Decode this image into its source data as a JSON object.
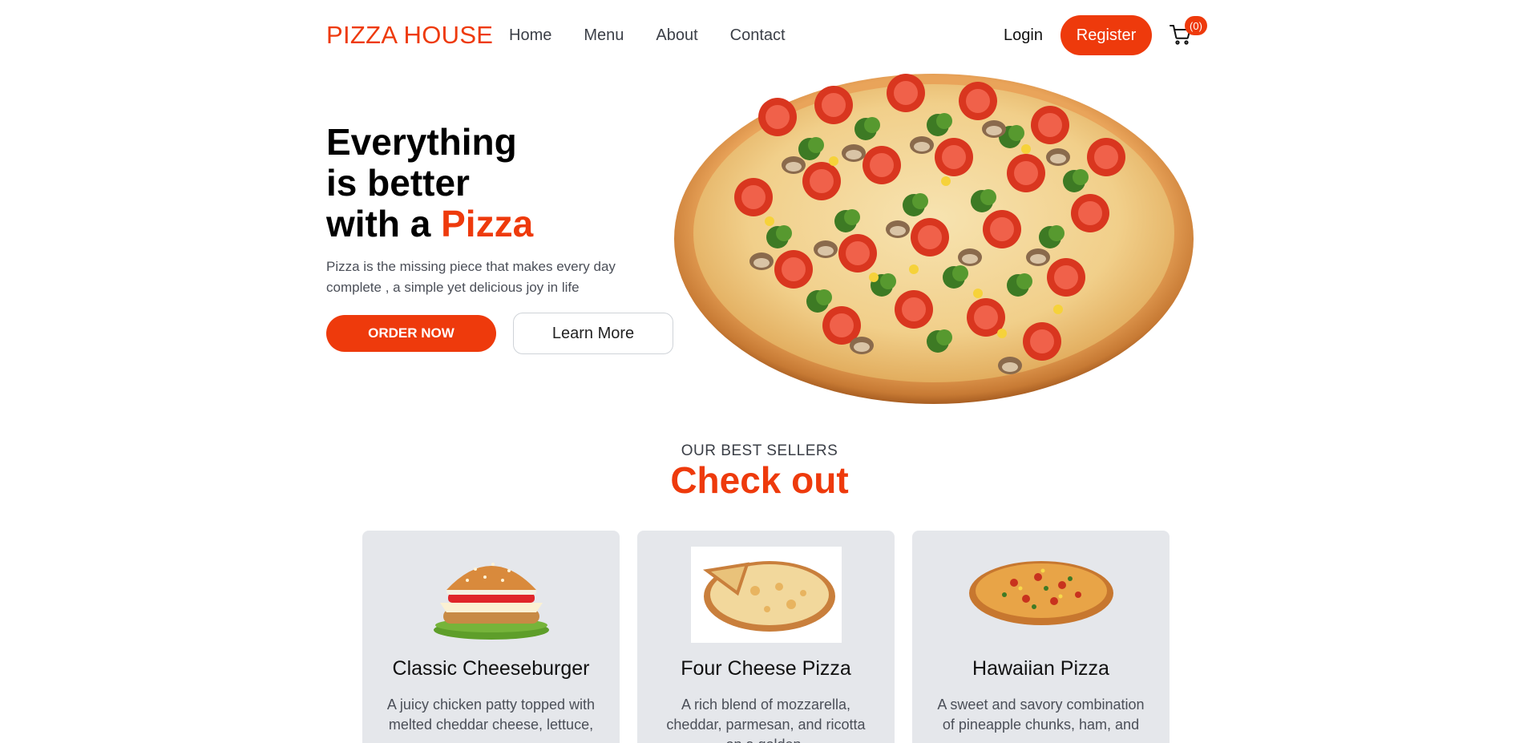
{
  "nav": {
    "logo": "PIZZA HOUSE",
    "links": [
      "Home",
      "Menu",
      "About",
      "Contact"
    ],
    "login": "Login",
    "register": "Register",
    "cart_count": "(0)"
  },
  "hero": {
    "title_line1": "Everything",
    "title_line2": "is better",
    "title_line3_prefix": "with a ",
    "title_line3_accent": "Pizza",
    "description": "Pizza is the missing piece that makes every day complete , a simple yet delicious joy in life",
    "order_button": "ORDER NOW",
    "learn_button": "Learn More"
  },
  "best_sellers": {
    "subtitle": "OUR BEST SELLERS",
    "title": "Check out",
    "items": [
      {
        "name": "Classic Cheeseburger",
        "description": "A juicy chicken patty topped with melted cheddar cheese, lettuce,",
        "image": "burger-image"
      },
      {
        "name": "Four Cheese Pizza",
        "description": "A rich blend of mozzarella, cheddar, parmesan, and ricotta on a golden-",
        "image": "four-cheese-pizza-image"
      },
      {
        "name": "Hawaiian Pizza",
        "description": "A sweet and savory combination of pineapple chunks, ham, and",
        "image": "hawaiian-pizza-image"
      }
    ]
  },
  "colors": {
    "accent": "#ee3a0c",
    "card_bg": "#e5e7eb",
    "text_muted": "#4b4f58"
  }
}
